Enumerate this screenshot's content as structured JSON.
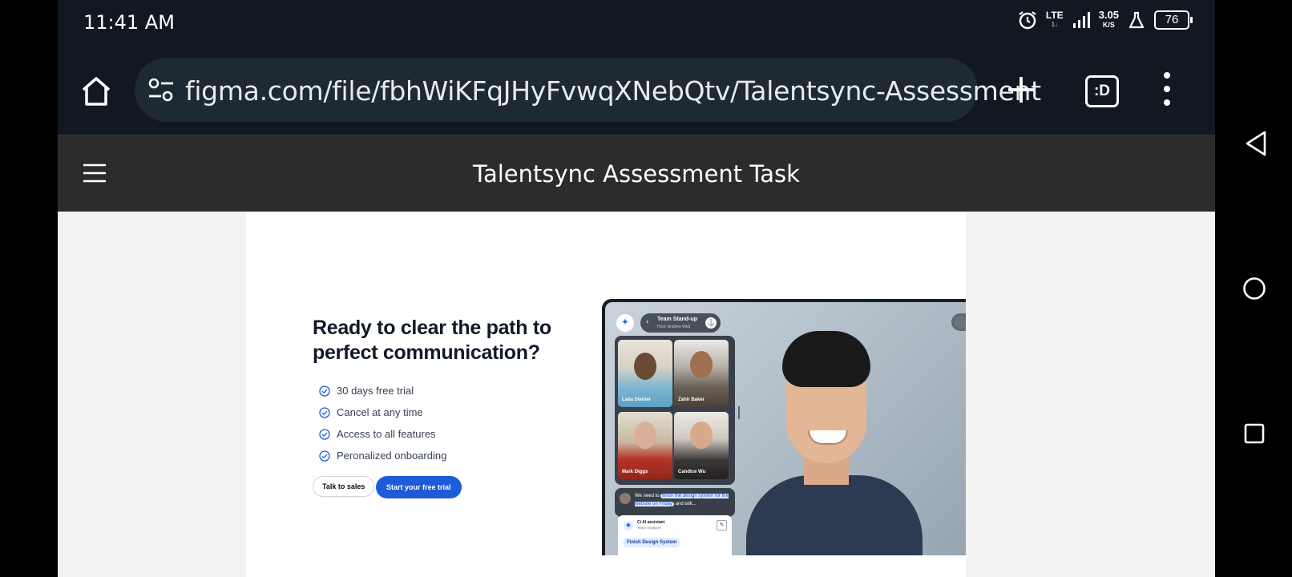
{
  "status_bar": {
    "time": "11:41 AM",
    "network": "LTE",
    "network_sub": "1↓",
    "speed_value": "3.05",
    "speed_unit": "K/S",
    "battery": "76"
  },
  "browser": {
    "url": "figma.com/file/fbhWiKFqJHyFvwqXNebQtv/Talentsync-Assessment",
    "tabs_label": ":D"
  },
  "figma": {
    "file_title": "Talentsync Assessment Task"
  },
  "cta": {
    "heading": "Ready to clear the path to perfect communication?",
    "features": [
      "30 days free trial",
      "Cancel at any time",
      "Access to all features",
      "Peronalized onboarding"
    ],
    "talk_to_sales": "Talk to sales",
    "start_trial": "Start your free trial"
  },
  "mockup": {
    "meeting_title": "Team Stand-up",
    "meeting_host": "Host: Andrew Wed",
    "participants": [
      "Lana Steiner",
      "Zahir Baker",
      "Mark Diggs",
      "Candice Wu"
    ],
    "chat_prefix": "We need to",
    "chat_highlight": "finish the design system for the website on Friday",
    "chat_suffix": "and talk...",
    "assistant_title": "Ci AI assistant",
    "assistant_sub": "Team Analyzer",
    "task_pill": "Finish Design System"
  },
  "colors": {
    "primary": "#1e5bd8",
    "browser_bg": "#111821",
    "figma_header": "#2c2c2c"
  }
}
